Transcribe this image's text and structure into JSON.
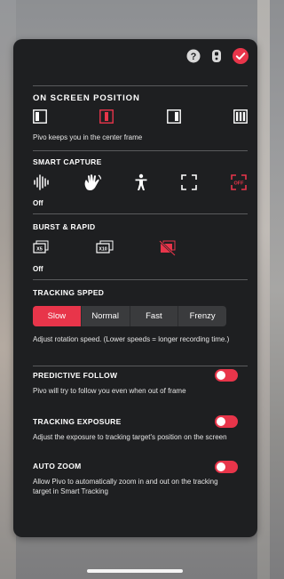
{
  "colors": {
    "accent": "#e8354a",
    "panel": "#1e1f21",
    "divider": "#5a5b5d"
  },
  "top_icons": [
    "help-icon",
    "device-icon",
    "confirm-check-icon"
  ],
  "position": {
    "title": "ON SCREEN POSITION",
    "options": [
      "left-frame-icon",
      "center-frame-icon",
      "right-frame-icon",
      "wide-frame-icon"
    ],
    "selected": "center-frame-icon",
    "description": "Pivo keeps you in the center frame"
  },
  "smart_capture": {
    "title": "SMART CAPTURE",
    "options": [
      "sound-wave-icon",
      "hand-wave-icon",
      "person-pose-icon",
      "frame-icon",
      "off-icon"
    ],
    "selected": "off-icon",
    "off_icon_label": "OFF",
    "status": "Off"
  },
  "burst": {
    "title": "BURST & RAPID",
    "x5_label": "X5",
    "x10_label": "X10",
    "options": [
      "burst-x5-icon",
      "burst-x10-icon",
      "burst-off-icon"
    ],
    "selected": "burst-off-icon",
    "status": "Off"
  },
  "tracking_speed": {
    "title": "TRACKING SPPED",
    "options": [
      "Slow",
      "Normal",
      "Fast",
      "Frenzy"
    ],
    "selected": "Slow",
    "description": "Adjust rotation speed. (Lower speeds = longer recording time.)"
  },
  "predictive_follow": {
    "title": "PREDICTIVE FOLLOW",
    "description": "Pivo will try to follow you even when out of frame",
    "enabled": true
  },
  "tracking_exposure": {
    "title": "TRACKING EXPOSURE",
    "description": "Adjust the exposure to tracking target's position on the screen",
    "enabled": true
  },
  "auto_zoom": {
    "title": "AUTO ZOOM",
    "description": "Allow Pivo to automatically zoom in and out on the tracking target in Smart Tracking",
    "enabled": true
  }
}
